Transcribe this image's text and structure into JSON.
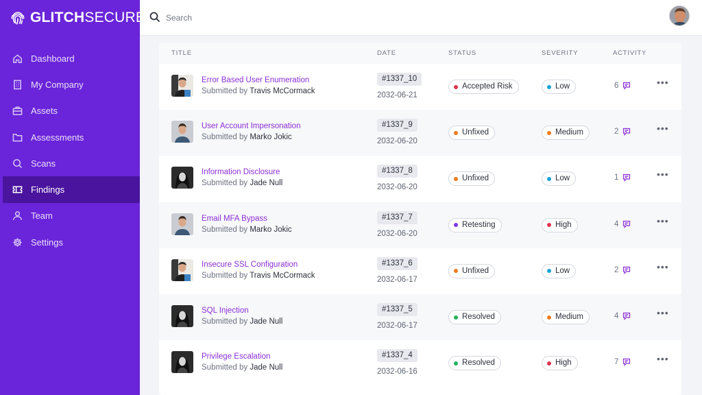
{
  "brand": {
    "part1": "GLITCH",
    "part2": "SECURE"
  },
  "nav": [
    {
      "label": "Dashboard",
      "icon": "home-icon"
    },
    {
      "label": "My Company",
      "icon": "building-icon"
    },
    {
      "label": "Assets",
      "icon": "briefcase-icon"
    },
    {
      "label": "Assessments",
      "icon": "folder-icon"
    },
    {
      "label": "Scans",
      "icon": "search-icon"
    },
    {
      "label": "Findings",
      "icon": "ticket-icon",
      "active": true
    },
    {
      "label": "Team",
      "icon": "users-icon"
    },
    {
      "label": "Settings",
      "icon": "gear-icon"
    }
  ],
  "search": {
    "placeholder": "Search",
    "value": ""
  },
  "table": {
    "headers": {
      "title": "TITLE",
      "date": "DATE",
      "status": "STATUS",
      "severity": "SEVERITY",
      "activity": "ACTIVITY"
    },
    "submitted_prefix": "Submitted by",
    "rows": [
      {
        "title": "Error Based User Enumeration",
        "submitter": "Travis McCormack",
        "id": "#1337_10",
        "date": "2032-06-21",
        "status": "Accepted Risk",
        "severity": "Low",
        "comments": "6"
      },
      {
        "title": "User Account Impersonation",
        "submitter": "Marko Jokic",
        "id": "#1337_9",
        "date": "2032-06-20",
        "status": "Unfixed",
        "severity": "Medium",
        "comments": "2"
      },
      {
        "title": "Information Disclosure",
        "submitter": "Jade Null",
        "id": "#1337_8",
        "date": "2032-06-20",
        "status": "Unfixed",
        "severity": "Low",
        "comments": "1"
      },
      {
        "title": "Email MFA Bypass",
        "submitter": "Marko Jokic",
        "id": "#1337_7",
        "date": "2032-06-20",
        "status": "Retesting",
        "severity": "High",
        "comments": "4"
      },
      {
        "title": "Insecure SSL Configuration",
        "submitter": "Travis McCormack",
        "id": "#1337_6",
        "date": "2032-06-17",
        "status": "Unfixed",
        "severity": "Low",
        "comments": "2"
      },
      {
        "title": "SQL Injection",
        "submitter": "Jade Null",
        "id": "#1337_5",
        "date": "2032-06-17",
        "status": "Resolved",
        "severity": "Medium",
        "comments": "4"
      },
      {
        "title": "Privilege Escalation",
        "submitter": "Jade Null",
        "id": "#1337_4",
        "date": "2032-06-16",
        "status": "Resolved",
        "severity": "High",
        "comments": "7"
      }
    ]
  },
  "colors": {
    "sidebar": "#6a24d9",
    "sidebar_active": "#4a149f",
    "link": "#8b2fd6",
    "status": {
      "Accepted Risk": "#e0334d",
      "Unfixed": "#f07a1c",
      "Retesting": "#7c3aed",
      "Resolved": "#22b35a"
    },
    "severity": {
      "Low": "#1aa0d8",
      "Medium": "#f07a1c",
      "High": "#e0334d"
    }
  }
}
